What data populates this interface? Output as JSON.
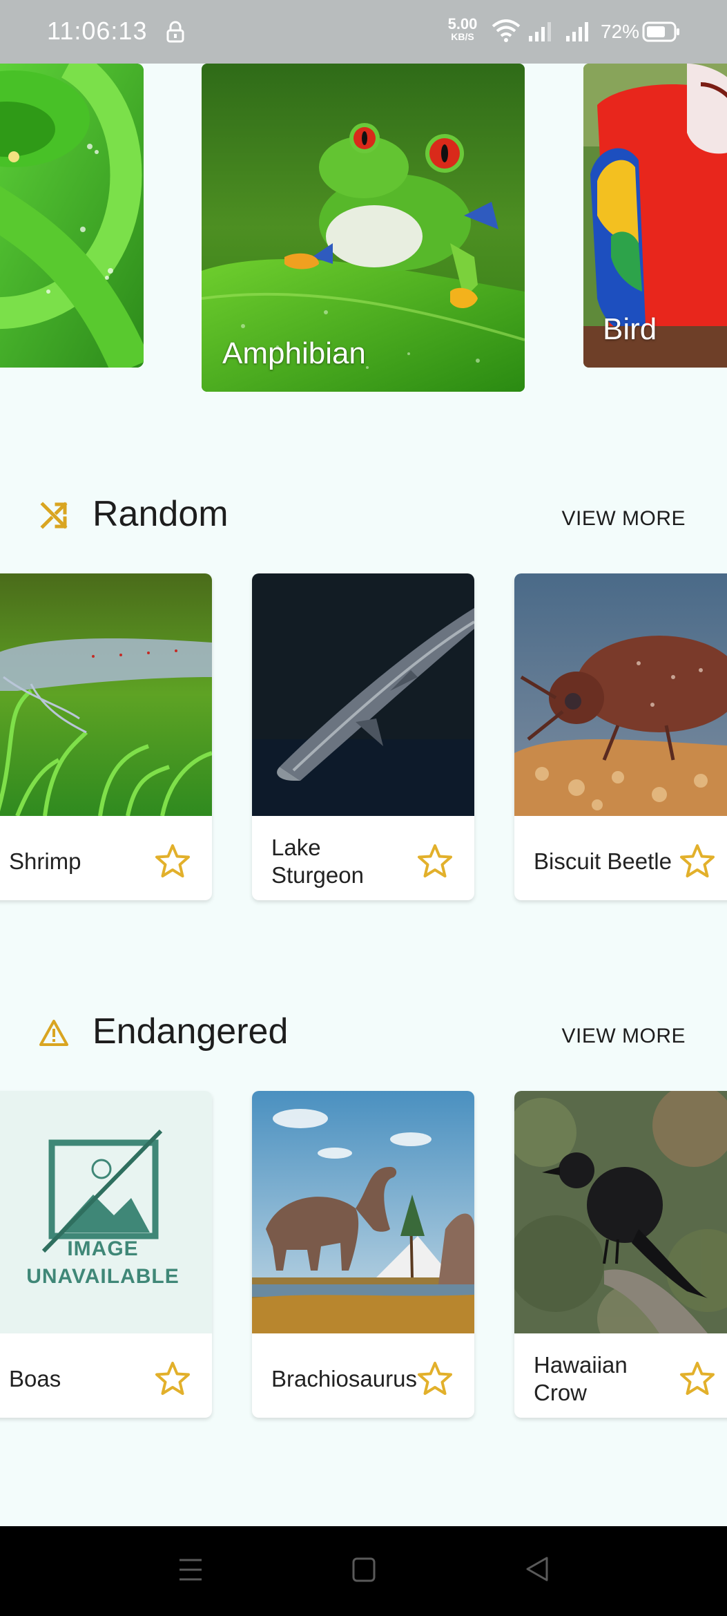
{
  "status_bar": {
    "time": "11:06:13",
    "net_speed_value": "5.00",
    "net_speed_unit": "KB/S",
    "battery": "72%",
    "icons": [
      "lock-icon",
      "wifi-icon",
      "signal-icon",
      "signal-icon",
      "battery-icon"
    ]
  },
  "categories": [
    {
      "label": "",
      "icon": "snake-image"
    },
    {
      "label": "Amphibian",
      "icon": "frog-image"
    },
    {
      "label": "Bird",
      "icon": "parrot-image"
    }
  ],
  "random": {
    "title": "Random",
    "icon": "shuffle-icon",
    "view_more": "VIEW MORE",
    "items": [
      {
        "name": "Shrimp",
        "icon": "star-icon"
      },
      {
        "name": "Lake Sturgeon",
        "icon": "star-icon"
      },
      {
        "name": "Biscuit Beetle",
        "icon": "star-icon"
      }
    ]
  },
  "endangered": {
    "title": "Endangered",
    "icon": "warning-icon",
    "view_more": "VIEW MORE",
    "items": [
      {
        "name": "Boas",
        "icon": "star-icon",
        "placeholder_line1": "IMAGE",
        "placeholder_line2": "UNAVAILABLE"
      },
      {
        "name": "Brachiosaurus",
        "icon": "star-icon"
      },
      {
        "name": "Hawaiian Crow",
        "icon": "star-icon"
      }
    ]
  },
  "colors": {
    "background": "#f3fcfb",
    "accent": "#d9a521",
    "status_bar": "#b8bcbd",
    "placeholder": "#3f8777"
  },
  "nav_bar": {
    "icons": [
      "menu-icon",
      "home-icon",
      "back-icon"
    ]
  }
}
